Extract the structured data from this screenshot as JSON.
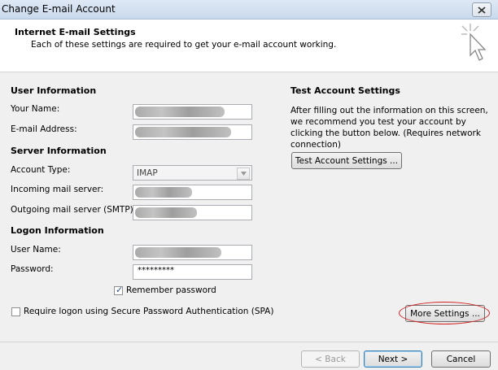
{
  "window": {
    "title": "Change E-mail Account",
    "close_icon": "close-icon"
  },
  "header": {
    "title": "Internet E-mail Settings",
    "subtitle": "Each of these settings are required to get your e-mail account working.",
    "icon": "cursor-sparkle-icon"
  },
  "user_info": {
    "heading": "User Information",
    "your_name_label": "Your Name:",
    "email_label": "E-mail Address:"
  },
  "server_info": {
    "heading": "Server Information",
    "account_type_label": "Account Type:",
    "account_type_value": "IMAP",
    "incoming_label": "Incoming mail server:",
    "outgoing_label": "Outgoing mail server (SMTP):"
  },
  "logon_info": {
    "heading": "Logon Information",
    "username_label": "User Name:",
    "password_label": "Password:",
    "password_value": "*********",
    "remember_label": "Remember password",
    "remember_checked": true,
    "spa_label": "Require logon using Secure Password Authentication (SPA)",
    "spa_checked": false
  },
  "test": {
    "heading": "Test Account Settings",
    "description": "After filling out the information on this screen, we recommend you test your account by clicking the button below. (Requires network connection)",
    "button_label": "Test Account Settings ..."
  },
  "more_settings_label": "More Settings ...",
  "footer": {
    "back_label": "< Back",
    "next_label": "Next >",
    "cancel_label": "Cancel"
  }
}
